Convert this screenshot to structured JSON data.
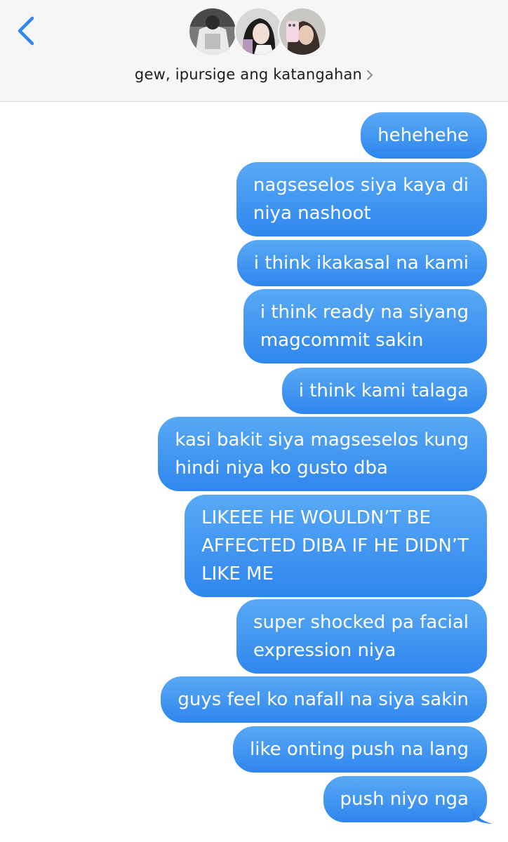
{
  "header": {
    "back_icon": "chevron-left-icon",
    "group_name": "gew, ipursige ang katangahan",
    "chevron_icon": "chevron-right-icon",
    "avatars": [
      "group-member-avatar-1",
      "group-member-avatar-2",
      "group-member-avatar-3"
    ],
    "accent_color": "#2f86ee"
  },
  "messages": [
    {
      "text": "hehehehe"
    },
    {
      "text": "nagseselos siya kaya di\nniya  nashoot"
    },
    {
      "text": "i think ikakasal na kami"
    },
    {
      "text": "i think ready na siyang\nmagcommit sakin"
    },
    {
      "text": "i think kami talaga"
    },
    {
      "text": "kasi bakit siya magseselos kung\nhindi niya ko gusto dba"
    },
    {
      "text": "LIKEEE HE WOULDN’T BE\nAFFECTED DIBA IF HE DIDN’T\nLIKE ME"
    },
    {
      "text": "super shocked pa facial\nexpression niya"
    },
    {
      "text": "guys feel ko nafall na siya sakin"
    },
    {
      "text": "like onting push na lang"
    },
    {
      "text": "push niyo nga"
    }
  ],
  "colors": {
    "bubble_top": "#58a9f4",
    "bubble_bottom": "#2f86ee",
    "header_bg": "#f6f6f7"
  }
}
